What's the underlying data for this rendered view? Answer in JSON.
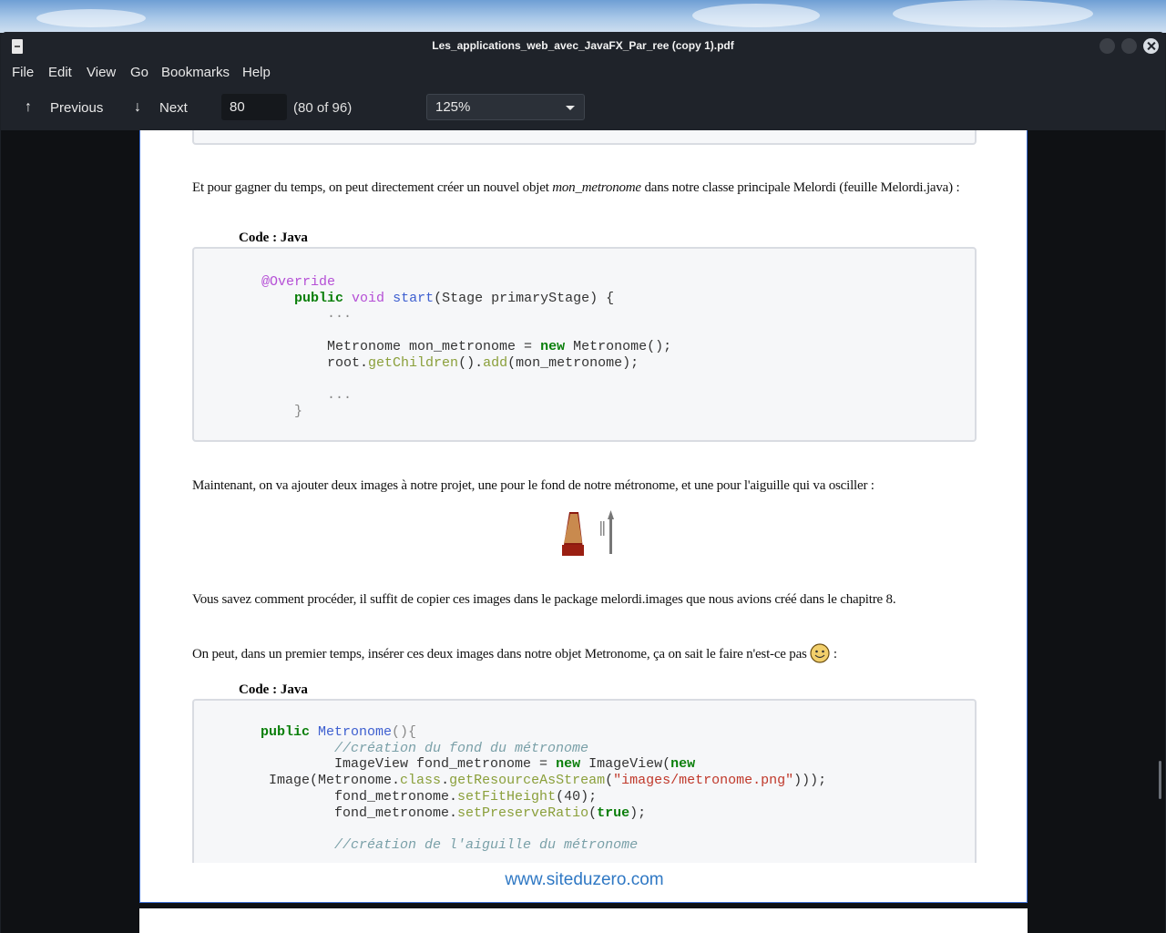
{
  "window": {
    "title": "Les_applications_web_avec_JavaFX_Par_ree (copy 1).pdf"
  },
  "menu": [
    "File",
    "Edit",
    "View",
    "Go",
    "Bookmarks",
    "Help"
  ],
  "toolbar": {
    "previous_label": "Previous",
    "next_label": "Next",
    "page_value": "80",
    "page_count": "(80 of 96)",
    "zoom_value": "125%"
  },
  "document": {
    "para1_a": "Et pour gagner du temps, on peut directement créer un nouvel objet ",
    "para1_em": "mon_metronome",
    "para1_b": " dans notre classe principale Melordi (feuille Melordi.java) :",
    "code_label_1": "Code : Java",
    "code1": {
      "line1": "@Override",
      "line2_kw": "public",
      "line2_void": "void",
      "line2_fn": "start",
      "line2_rest": "(Stage primaryStage) {",
      "line3": "...",
      "line4_a": "Metronome mon_metronome = ",
      "line4_kw": "new",
      "line4_b": " Metronome();",
      "line5_a": "root.",
      "line5_m1": "getChildren",
      "line5_b": "().",
      "line5_m2": "add",
      "line5_c": "(mon_metronome);",
      "line6": "...",
      "line7": "}"
    },
    "para2": "Maintenant, on va ajouter deux images à notre projet, une pour le fond de notre métronome, et une pour l'aiguille qui va osciller :",
    "para3": "Vous savez comment procéder, il suffit de copier ces images dans le package melordi.images que nous avions créé dans le chapitre 8.",
    "para4": "On peut, dans un premier temps, insérer ces deux images dans notre objet Metronome, ça on sait le faire n'est-ce pas",
    "para4_end": " :",
    "code_label_2": "Code : Java",
    "code2": {
      "l1_kw": "public",
      "l1_fn": "Metronome",
      "l1_rest": "(){",
      "l2": "//création du fond du métronome",
      "l3_a": "ImageView fond_metronome = ",
      "l3_kw1": "new",
      "l3_b": " ImageView(",
      "l3_kw2": "new",
      "l4_a": "Image(Metronome.",
      "l4_m1": "class",
      "l4_b": ".",
      "l4_m2": "getResourceAsStream",
      "l4_c": "(",
      "l4_str": "\"images/metronome.png\"",
      "l4_d": ")));",
      "l5_a": "fond_metronome.",
      "l5_m": "setFitHeight",
      "l5_b": "(40);",
      "l6_a": "fond_metronome.",
      "l6_m": "setPreserveRatio",
      "l6_b": "(",
      "l6_kw": "true",
      "l6_c": ");",
      "l7": "//création de l'aiguille du métronome"
    },
    "footer_link": "www.siteduzero.com"
  },
  "icons": [
    "app-document-icon",
    "arrow-up-icon",
    "arrow-down-icon",
    "dropdown-caret-icon",
    "metronome-image",
    "needle-image",
    "smiley-icon"
  ]
}
